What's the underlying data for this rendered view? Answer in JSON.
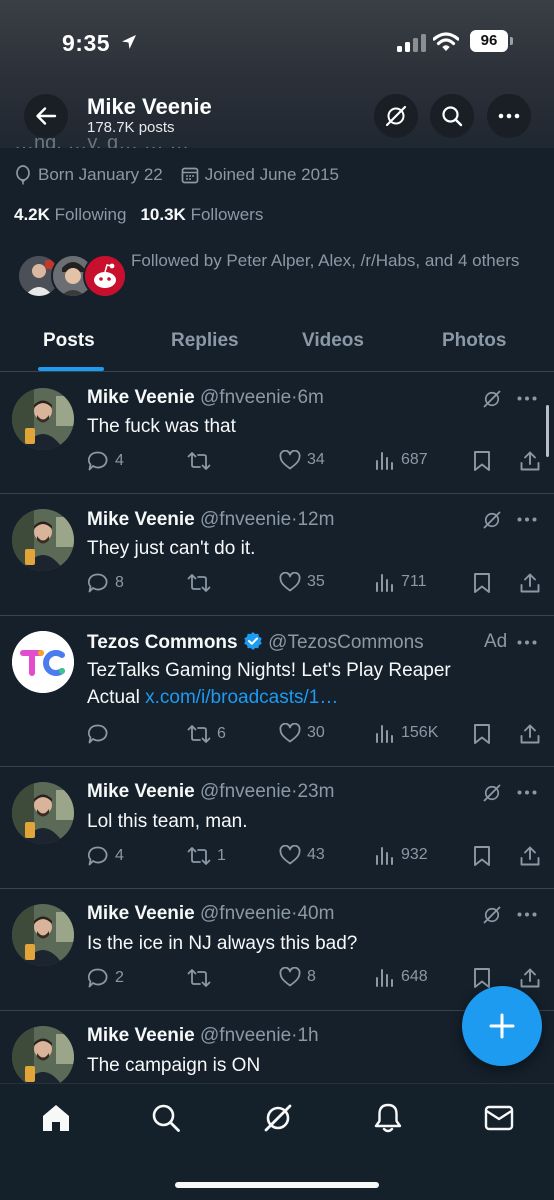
{
  "status_bar": {
    "time": "9:35",
    "battery": "96"
  },
  "header": {
    "name": "Mike Veenie",
    "post_count": "178.7K posts",
    "ghost_text": "…ng, …y, g… … …"
  },
  "profile": {
    "born": "Born January 22",
    "joined": "Joined June 2015",
    "following_count": "4.2K",
    "following_label": "Following",
    "followers_count": "10.3K",
    "followers_label": "Followers",
    "followed_by": "Followed by Peter Alper, Alex, /r/Habs, and 4 others"
  },
  "tabs": [
    {
      "label": "Posts",
      "active": true
    },
    {
      "label": "Replies"
    },
    {
      "label": "Videos"
    },
    {
      "label": "Photos"
    }
  ],
  "posts": [
    {
      "name": "Mike Veenie",
      "handle": "@fnveenie",
      "time": "6m",
      "text": "The fuck was that",
      "replies": "4",
      "reposts": "",
      "likes": "34",
      "views": "687"
    },
    {
      "name": "Mike Veenie",
      "handle": "@fnveenie",
      "time": "12m",
      "text": "They just can't do it.",
      "replies": "8",
      "reposts": "",
      "likes": "35",
      "views": "711"
    },
    {
      "name": "Tezos Commons",
      "handle": "@TezosCommons",
      "ad_label": "Ad",
      "text": "TezTalks Gaming Nights! Let's Play Reaper Actual ",
      "link": "x.com/i/broadcasts/1…",
      "replies": "",
      "reposts": "6",
      "likes": "30",
      "views": "156K"
    },
    {
      "name": "Mike Veenie",
      "handle": "@fnveenie",
      "time": "23m",
      "text": "Lol this team, man.",
      "replies": "4",
      "reposts": "1",
      "likes": "43",
      "views": "932"
    },
    {
      "name": "Mike Veenie",
      "handle": "@fnveenie",
      "time": "40m",
      "text": "Is the ice in NJ always this bad?",
      "replies": "2",
      "reposts": "",
      "likes": "8",
      "views": "648"
    },
    {
      "name": "Mike Veenie",
      "handle": "@fnveenie",
      "time": "1h",
      "text": "The campaign is ON"
    }
  ],
  "colors": {
    "accent": "#1d9bf0",
    "background": "#15202b",
    "muted": "#8b98a5",
    "divider": "#38444d"
  },
  "icons": [
    "back-arrow-icon",
    "grok-icon",
    "search-icon",
    "more-icon",
    "birthday-balloon-icon",
    "calendar-icon",
    "reply-icon",
    "repost-icon",
    "like-icon",
    "views-icon",
    "bookmark-icon",
    "share-icon",
    "verified-badge-icon",
    "compose-plus-icon",
    "home-icon",
    "bell-icon",
    "mail-icon"
  ]
}
